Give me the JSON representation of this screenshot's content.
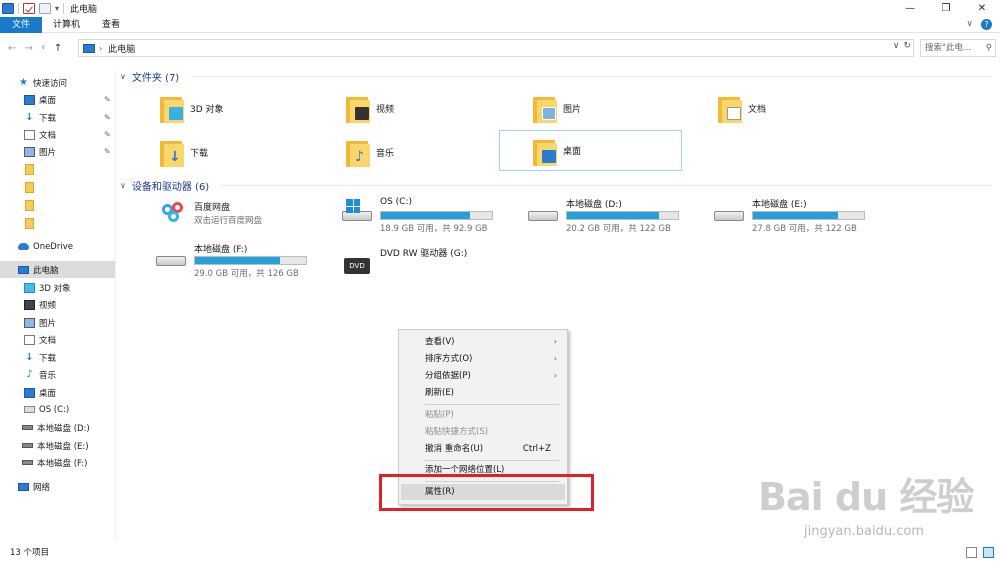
{
  "window": {
    "title": "此电脑",
    "controls": {
      "minimize": "—",
      "maximize": "❐",
      "close": "✕"
    }
  },
  "ribbon": {
    "tabs": [
      "文件",
      "计算机",
      "查看"
    ],
    "expand": "∨",
    "help": "?"
  },
  "address": {
    "back": "←",
    "forward": "→",
    "recent": "∨",
    "up": "↑",
    "crumb_sep": "›",
    "path": "此电脑",
    "dropdown": "∨",
    "refresh": "↻",
    "search_placeholder": "搜索\"此电...",
    "search_icon": "⚲"
  },
  "sidebar": {
    "quick_access": "快速访问",
    "pinned": [
      {
        "label": "桌面",
        "icon": "desktop-icon"
      },
      {
        "label": "下载",
        "icon": "download-icon"
      },
      {
        "label": "文档",
        "icon": "document-icon"
      },
      {
        "label": "图片",
        "icon": "picture-icon"
      }
    ],
    "pin_glyph": "📌",
    "onedrive": "OneDrive",
    "this_pc": "此电脑",
    "pc_children": [
      {
        "label": "3D 对象",
        "icon": "3d-objects-icon"
      },
      {
        "label": "视频",
        "icon": "video-icon"
      },
      {
        "label": "图片",
        "icon": "picture-icon"
      },
      {
        "label": "文档",
        "icon": "document-icon"
      },
      {
        "label": "下载",
        "icon": "download-icon"
      },
      {
        "label": "音乐",
        "icon": "music-icon"
      },
      {
        "label": "桌面",
        "icon": "desktop-icon"
      },
      {
        "label": "OS (C:)",
        "icon": "os-drive-icon"
      },
      {
        "label": "本地磁盘 (D:)",
        "icon": "drive-icon"
      },
      {
        "label": "本地磁盘 (E:)",
        "icon": "drive-icon"
      },
      {
        "label": "本地磁盘 (F:)",
        "icon": "drive-icon"
      }
    ],
    "network": "网络"
  },
  "folders_section": {
    "title": "文件夹 (7)",
    "items": [
      {
        "label": "3D 对象",
        "icon": "3d-objects-folder-icon"
      },
      {
        "label": "视频",
        "icon": "video-folder-icon"
      },
      {
        "label": "图片",
        "icon": "picture-folder-icon"
      },
      {
        "label": "文档",
        "icon": "document-folder-icon"
      },
      {
        "label": "下载",
        "icon": "download-folder-icon"
      },
      {
        "label": "音乐",
        "icon": "music-folder-icon"
      },
      {
        "label": "桌面",
        "icon": "desktop-folder-icon"
      }
    ]
  },
  "devices_section": {
    "title": "设备和驱动器 (6)",
    "drives": [
      {
        "name": "百度网盘",
        "info": "双击运行百度网盘",
        "icon": "baidu-netdisk-icon"
      },
      {
        "name": "OS (C:)",
        "info": "18.9 GB 可用，共 92.9 GB",
        "used_fraction": 0.8,
        "icon": "os-drive-icon"
      },
      {
        "name": "本地磁盘 (D:)",
        "info": "20.2 GB 可用，共 122 GB",
        "used_fraction": 0.83,
        "icon": "hdd-icon"
      },
      {
        "name": "本地磁盘 (E:)",
        "info": "27.8 GB 可用，共 122 GB",
        "used_fraction": 0.77,
        "icon": "hdd-icon"
      },
      {
        "name": "本地磁盘 (F:)",
        "info": "29.0 GB 可用，共 126 GB",
        "used_fraction": 0.77,
        "icon": "hdd-icon"
      },
      {
        "name": "DVD RW 驱动器 (G:)",
        "info": "",
        "icon": "dvd-drive-icon",
        "badge": "DVD"
      }
    ]
  },
  "context_menu": {
    "items": [
      {
        "label": "查看(V)",
        "submenu": true
      },
      {
        "label": "排序方式(O)",
        "submenu": true
      },
      {
        "label": "分组依据(P)",
        "submenu": true
      },
      {
        "label": "刷新(E)"
      },
      {
        "label": "粘贴(P)",
        "disabled": true
      },
      {
        "label": "粘贴快捷方式(S)",
        "disabled": true
      },
      {
        "label": "撤消 重命名(U)",
        "accel": "Ctrl+Z"
      },
      {
        "label": "添加一个网络位置(L)"
      },
      {
        "label": "属性(R)",
        "highlighted": true
      }
    ],
    "submenu_arrow": "›"
  },
  "watermark": {
    "logo": "Bai  du 经验",
    "url": "jingyan.baidu.com"
  },
  "status": {
    "count": "13 个项目"
  },
  "colors": {
    "accent": "#1979ca",
    "highlight_box": "#e0202a",
    "drive_bar": "#26a0da"
  }
}
